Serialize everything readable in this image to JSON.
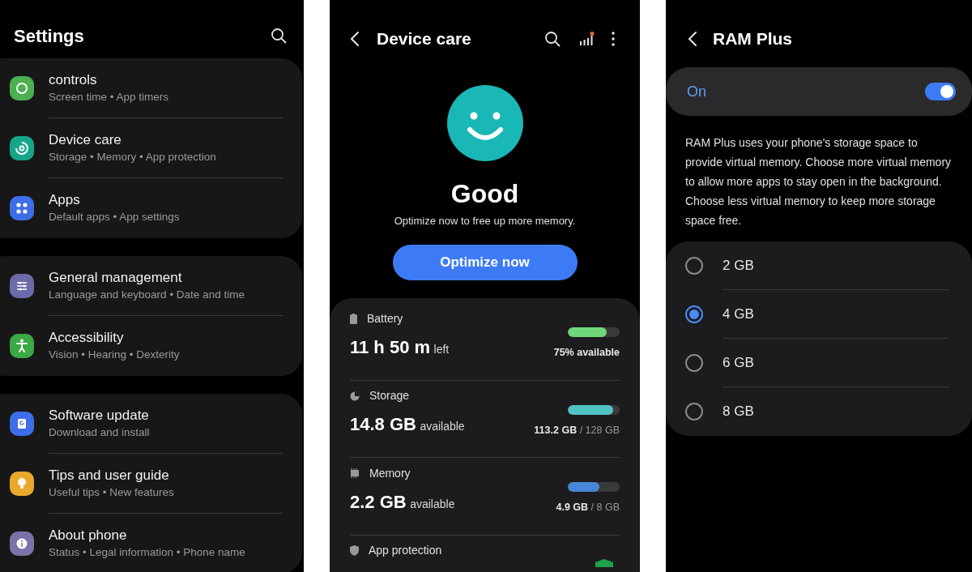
{
  "settings": {
    "title": "Settings",
    "groups": [
      [
        {
          "title": "controls",
          "subtitle": "Screen time • App timers",
          "color": "#4caf50"
        },
        {
          "title": "Device care",
          "subtitle": "Storage • Memory • App protection",
          "color": "#17a589"
        },
        {
          "title": "Apps",
          "subtitle": "Default apps • App settings",
          "color": "#3d6ee8"
        }
      ],
      [
        {
          "title": "General management",
          "subtitle": "Language and keyboard • Date and time",
          "color": "#6c6aa8"
        },
        {
          "title": "Accessibility",
          "subtitle": "Vision • Hearing • Dexterity",
          "color": "#3aa845"
        }
      ],
      [
        {
          "title": "Software update",
          "subtitle": "Download and install",
          "color": "#3d6ee8"
        },
        {
          "title": "Tips and user guide",
          "subtitle": "Useful tips • New features",
          "color": "#e8a92c"
        },
        {
          "title": "About phone",
          "subtitle": "Status • Legal information • Phone name",
          "color": "#7a72a8"
        }
      ]
    ]
  },
  "device_care": {
    "title": "Device care",
    "status": "Good",
    "message": "Optimize now to free up more memory.",
    "button": "Optimize now",
    "stats": [
      {
        "label": "Battery",
        "value": "11 h 50 m",
        "unit": "left",
        "level": 0.75,
        "reading": "75% available",
        "color": "#6fd67a"
      },
      {
        "label": "Storage",
        "value": "14.8 GB",
        "unit": "available",
        "level": 0.88,
        "reading": "113.2 GB",
        "total": "/ 128 GB",
        "color": "#4fc4c2"
      },
      {
        "label": "Memory",
        "value": "2.2 GB",
        "unit": "available",
        "level": 0.61,
        "reading": "4.9 GB",
        "total": "/ 8 GB",
        "color": "#4a86d8"
      },
      {
        "label": "App protection"
      }
    ]
  },
  "ram_plus": {
    "title": "RAM Plus",
    "toggle": {
      "label": "On",
      "on": true
    },
    "description": "RAM Plus uses your phone's storage space to provide virtual memory. Choose more virtual memory to allow more apps to stay open in the background. Choose less virtual memory to keep more storage space free.",
    "options": [
      {
        "label": "2 GB",
        "selected": false
      },
      {
        "label": "4 GB",
        "selected": true
      },
      {
        "label": "6 GB",
        "selected": false
      },
      {
        "label": "8 GB",
        "selected": false
      }
    ]
  }
}
